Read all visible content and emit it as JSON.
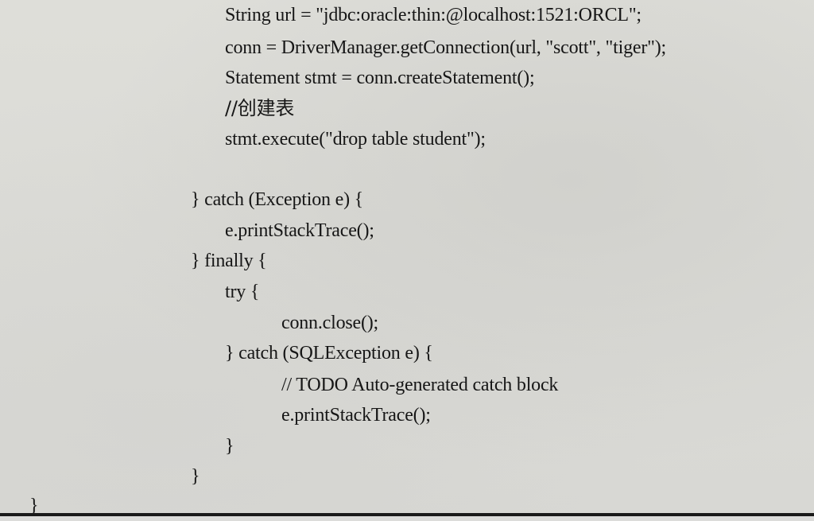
{
  "code": {
    "lines": [
      "String url = \"jdbc:oracle:thin:@localhost:1521:ORCL\";",
      "conn = DriverManager.getConnection(url, \"scott\", \"tiger\");",
      "Statement stmt = conn.createStatement();",
      "//创建表",
      "stmt.execute(\"drop table student\");",
      "} catch (Exception e) {",
      "e.printStackTrace();",
      "} finally {",
      "try {",
      "conn.close();",
      "} catch (SQLException e) {",
      "// TODO Auto-generated catch block",
      "e.printStackTrace();",
      "}",
      "}",
      "}"
    ]
  }
}
